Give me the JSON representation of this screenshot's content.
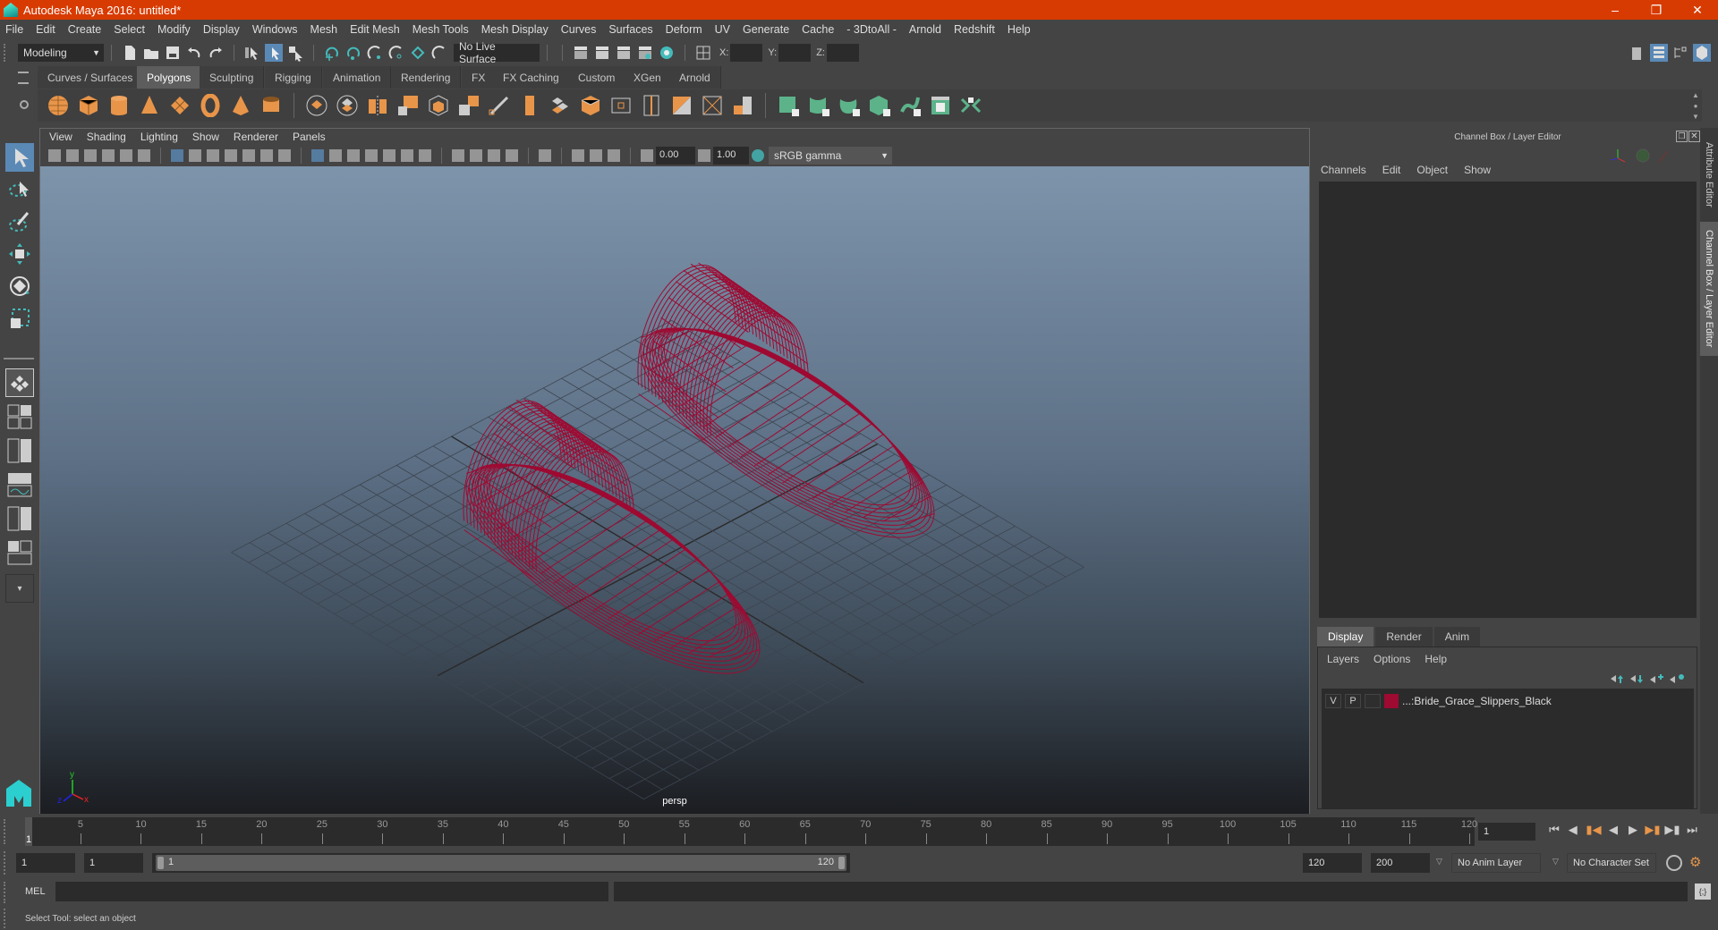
{
  "window": {
    "title": "Autodesk Maya 2016: untitled*",
    "controls": [
      "minimize",
      "restore",
      "close"
    ]
  },
  "menubar": [
    "File",
    "Edit",
    "Create",
    "Select",
    "Modify",
    "Display",
    "Windows",
    "Mesh",
    "Edit Mesh",
    "Mesh Tools",
    "Mesh Display",
    "Curves",
    "Surfaces",
    "Deform",
    "UV",
    "Generate",
    "Cache",
    "- 3DtoAll -",
    "Arnold",
    "Redshift",
    "Help"
  ],
  "statusline": {
    "mode": "Modeling",
    "live_surface": "No Live Surface",
    "x_label": "X:",
    "y_label": "Y:",
    "z_label": "Z:",
    "x_value": "",
    "y_value": "",
    "z_value": ""
  },
  "shelf_tabs": [
    {
      "label": "Curves / Surfaces",
      "active": false
    },
    {
      "label": "Polygons",
      "active": true
    },
    {
      "label": "Sculpting",
      "active": false
    },
    {
      "label": "Rigging",
      "active": false
    },
    {
      "label": "Animation",
      "active": false
    },
    {
      "label": "Rendering",
      "active": false
    },
    {
      "label": "FX",
      "active": false
    },
    {
      "label": "FX Caching",
      "active": false
    },
    {
      "label": "Custom",
      "active": false
    },
    {
      "label": "XGen",
      "active": false
    },
    {
      "label": "Arnold",
      "active": false
    }
  ],
  "shelf_icons": {
    "primitives": [
      "poly-sphere",
      "poly-cube",
      "poly-cylinder",
      "poly-cone",
      "poly-plane",
      "poly-torus",
      "poly-pyramid",
      "poly-pipe"
    ],
    "mesh_ops": [
      "combine",
      "separate",
      "mirror",
      "smooth",
      "extract",
      "fill-hole",
      "bridge",
      "append-polygon",
      "multi-cut",
      "extrude",
      "bevel",
      "insert-edge-loop",
      "offset-edge-loop",
      "triangulate",
      "quadrangulate",
      "merge"
    ],
    "uv_ops": [
      "planar-map",
      "cylindrical-map",
      "spherical-map",
      "automatic-map",
      "unfold",
      "uv-editor",
      "layout"
    ]
  },
  "viewport": {
    "menu": [
      "View",
      "Shading",
      "Lighting",
      "Show",
      "Renderer",
      "Panels"
    ],
    "exposure": "0.00",
    "gamma": "1.00",
    "color_space": "sRGB gamma",
    "camera_label": "persp",
    "axis": {
      "x": "x",
      "y": "y",
      "z": "z"
    },
    "object_color": "#9e0a32"
  },
  "channel_box": {
    "title": "Channel Box / Layer Editor",
    "menu": [
      "Channels",
      "Edit",
      "Object",
      "Show"
    ]
  },
  "layer_editor": {
    "tabs": [
      {
        "label": "Display",
        "active": true
      },
      {
        "label": "Render",
        "active": false
      },
      {
        "label": "Anim",
        "active": false
      }
    ],
    "menu": [
      "Layers",
      "Options",
      "Help"
    ],
    "layers": [
      {
        "visible": "V",
        "playback": "P",
        "name": "...:Bride_Grace_Slippers_Black",
        "color": "#9e0a32"
      }
    ]
  },
  "side_tabs": [
    "Attribute Editor",
    "Channel Box / Layer Editor"
  ],
  "timeslider": {
    "ticks": [
      5,
      10,
      15,
      20,
      25,
      30,
      35,
      40,
      45,
      50,
      55,
      60,
      65,
      70,
      75,
      80,
      85,
      90,
      95,
      100,
      105,
      110,
      115,
      120
    ],
    "current_marker": "1",
    "current_frame": "1",
    "start": 1,
    "end": 120
  },
  "range": {
    "start_time": "1",
    "playback_start": "1",
    "range_start_label": "1",
    "range_end_label": "120",
    "playback_end": "120",
    "end_time": "200",
    "anim_layer": "No Anim Layer",
    "character_set": "No Character Set"
  },
  "command_line": {
    "label": "MEL",
    "input": "",
    "result": ""
  },
  "help_line": "Select Tool: select an object"
}
